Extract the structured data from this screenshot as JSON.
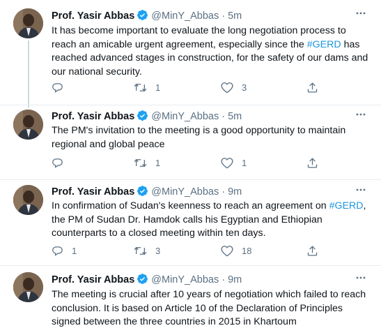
{
  "tweets": [
    {
      "name": "Prof. Yasir Abbas",
      "handle": "@MinY_Abbas",
      "separator": "·",
      "time": "5m",
      "text_parts": [
        "It has become important to evaluate the long negotiation process to reach an amicable urgent agreement, especially since the ",
        "#GERD",
        " has reached advanced stages in construction, for the safety of our dams and our national security."
      ],
      "replies": "",
      "retweets": "1",
      "likes": "3"
    },
    {
      "name": "Prof. Yasir Abbas",
      "handle": "@MinY_Abbas",
      "separator": "·",
      "time": "5m",
      "text_parts": [
        "The PM's invitation to the meeting is a good opportunity to maintain regional and global peace",
        "",
        ""
      ],
      "replies": "",
      "retweets": "1",
      "likes": "1"
    },
    {
      "name": "Prof. Yasir Abbas",
      "handle": "@MinY_Abbas",
      "separator": "·",
      "time": "9m",
      "text_parts": [
        "In confirmation of Sudan's keenness to reach an agreement on ",
        "#GERD",
        ", the PM of Sudan Dr. Hamdok calls his Egyptian and Ethiopian counterparts to a closed meeting within ten days."
      ],
      "replies": "1",
      "retweets": "3",
      "likes": "18"
    },
    {
      "name": "Prof. Yasir Abbas",
      "handle": "@MinY_Abbas",
      "separator": "·",
      "time": "9m",
      "text_parts": [
        "The meeting is crucial after 10 years of negotiation which failed to reach conclusion. It is based on Article 10 of the Declaration of Principles signed between the three countries in 2015 in Khartoum",
        "",
        ""
      ],
      "replies": "",
      "retweets": "",
      "likes": ""
    }
  ],
  "icons": {
    "verified": "verified-badge-icon",
    "more": "more-icon",
    "reply": "reply-icon",
    "retweet": "retweet-icon",
    "like": "like-icon",
    "share": "share-icon"
  },
  "colors": {
    "text": "#0f1419",
    "secondary": "#5b7083",
    "hashtag": "#1b95e0",
    "verified": "#1da1f2",
    "divider": "#e6ecf0",
    "thread_line": "#cfd9de"
  }
}
